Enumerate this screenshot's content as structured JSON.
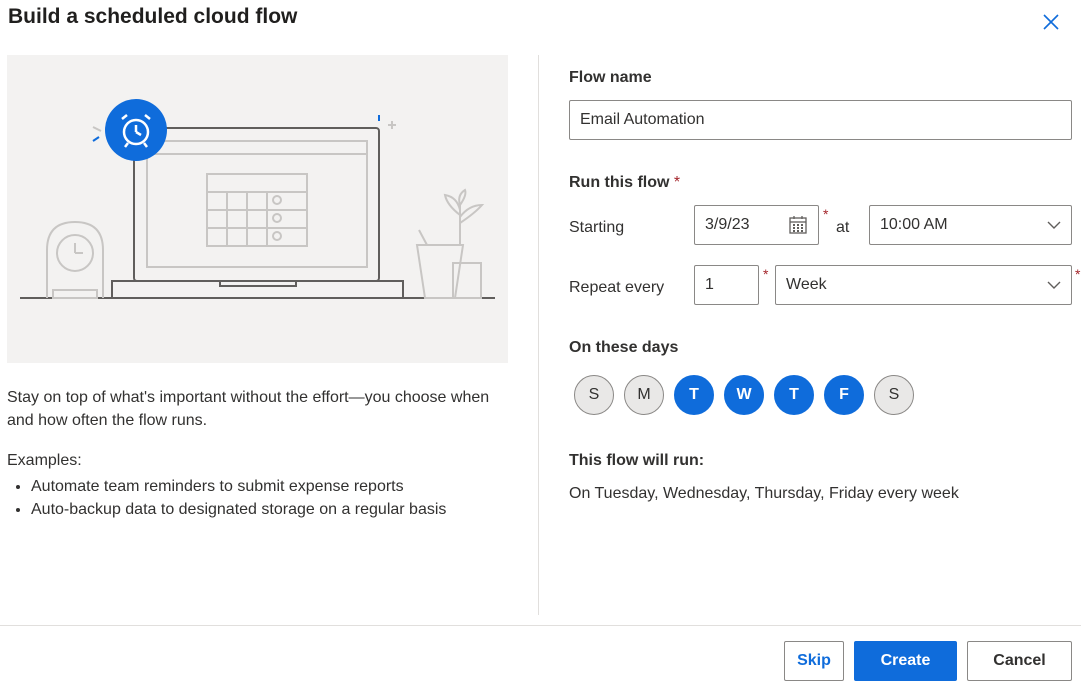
{
  "dialog": {
    "title": "Build a scheduled cloud flow",
    "description": "Stay on top of what's important without the effort—you choose when and how often the flow runs.",
    "examples_label": "Examples:",
    "examples": [
      "Automate team reminders to submit expense reports",
      "Auto-backup data to designated storage on a regular basis"
    ]
  },
  "form": {
    "flow_name_label": "Flow name",
    "flow_name_value": "Email Automation",
    "run_label": "Run this flow",
    "required_mark": "*",
    "starting_label": "Starting",
    "start_date": "3/9/23",
    "at_label": "at",
    "start_time": "10:00 AM",
    "repeat_label": "Repeat every",
    "repeat_interval": "1",
    "repeat_unit": "Week",
    "days_label": "On these days",
    "days": [
      {
        "letter": "S",
        "selected": false
      },
      {
        "letter": "M",
        "selected": false
      },
      {
        "letter": "T",
        "selected": true
      },
      {
        "letter": "W",
        "selected": true
      },
      {
        "letter": "T",
        "selected": true
      },
      {
        "letter": "F",
        "selected": true
      },
      {
        "letter": "S",
        "selected": false
      }
    ],
    "summary_label": "This flow will run:",
    "summary_text": "On Tuesday, Wednesday, Thursday, Friday every week"
  },
  "footer": {
    "skip_label": "Skip",
    "create_label": "Create",
    "cancel_label": "Cancel"
  },
  "icons": {
    "close": "close-icon",
    "calendar": "calendar-icon",
    "chevron": "chevron-down-icon",
    "alarm": "alarm-clock-icon"
  },
  "colors": {
    "accent": "#0f6cdb",
    "required": "#a4262c",
    "illustration_bg": "#f3f2f1"
  }
}
